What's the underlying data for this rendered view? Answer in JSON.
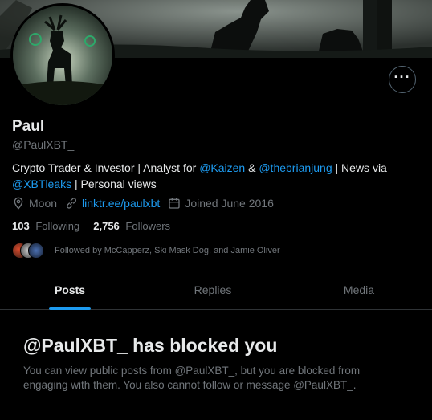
{
  "profile": {
    "name": "Paul",
    "handle": "@PaulXBT_",
    "bio": {
      "prefix": "Crypto Trader & Investor | Analyst for ",
      "mention1": "@Kaizen",
      "mid": " & ",
      "mention2": "@thebrianjung",
      "mid2": " | News via",
      "mention3": "@XBTleaks",
      "suffix": " | Personal views"
    },
    "location": "Moon",
    "website": "linktr.ee/paulxbt",
    "joined": "Joined June 2016",
    "following_count": "103",
    "following_label": "Following",
    "followers_count": "2,756",
    "followers_label": "Followers",
    "followed_by": "Followed by McCapperz, Ski Mask Dog, and Jamie Oliver"
  },
  "more_icon": "more-horizontal-icon",
  "tabs": [
    {
      "label": "Posts",
      "active": true
    },
    {
      "label": "Replies",
      "active": false
    },
    {
      "label": "Media",
      "active": false
    }
  ],
  "blocked": {
    "title": "@PaulXBT_ has blocked you",
    "description": "You can view public posts from @PaulXBT_, but you are blocked from engaging with them. You also cannot follow or message @PaulXBT_."
  },
  "colors": {
    "accent": "#1d9bf0",
    "background": "#000000",
    "secondary_text": "#71767b"
  }
}
